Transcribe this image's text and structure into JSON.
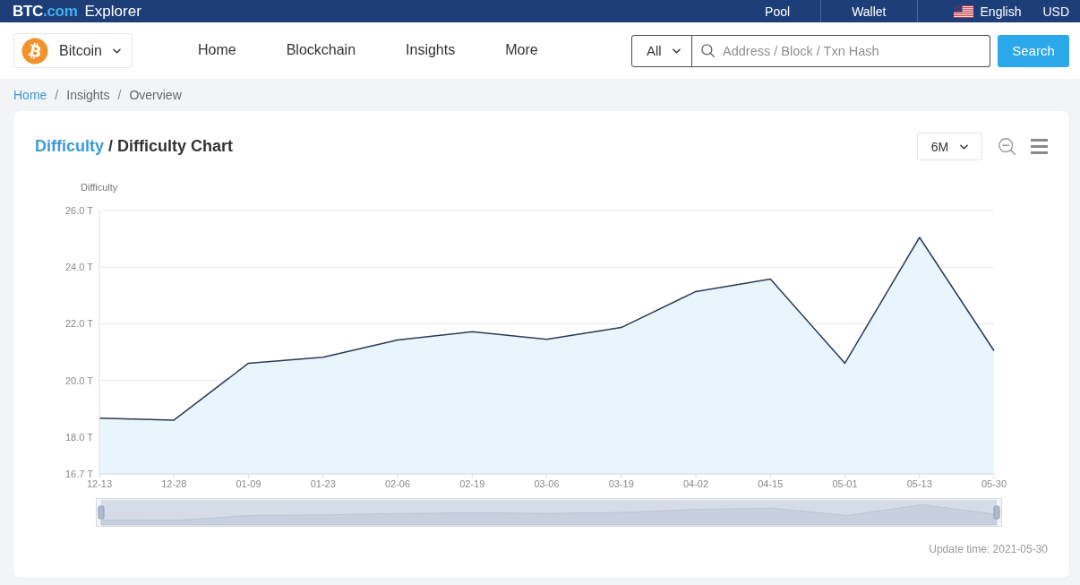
{
  "top_bar": {
    "logo": {
      "brand": "BTC",
      "domain": ".com",
      "product": "Explorer"
    },
    "links": [
      "Pool",
      "Wallet"
    ],
    "language": "English",
    "currency": "USD"
  },
  "nav": {
    "coin": "Bitcoin",
    "items": [
      {
        "label": "Home",
        "selected": false
      },
      {
        "label": "Blockchain",
        "selected": false
      },
      {
        "label": "Insights",
        "selected": false
      },
      {
        "label": "More",
        "selected": false
      }
    ],
    "search": {
      "scope": "All",
      "placeholder": "Address / Block / Txn Hash",
      "button": "Search"
    }
  },
  "breadcrumb": [
    {
      "label": "Home",
      "link": true
    },
    {
      "separator": "/",
      "label": "Insights",
      "link": false
    },
    {
      "separator": "/",
      "label": "Overview",
      "link": false
    }
  ],
  "card": {
    "title": {
      "parent": "Difficulty",
      "separator": "/",
      "current": "Difficulty Chart"
    },
    "period": "6M",
    "chart_data": {
      "type": "area",
      "ylabel": "Difficulty",
      "grid": true,
      "categories": [
        "12-13",
        "12-28",
        "01-09",
        "01-23",
        "02-06",
        "02-19",
        "03-06",
        "03-19",
        "04-02",
        "04-15",
        "05-01",
        "05-13",
        "05-30"
      ],
      "series": [
        {
          "color": "#2b3a55",
          "values": [
            18.67,
            18.6,
            20.61,
            20.82,
            21.43,
            21.72,
            21.45,
            21.87,
            23.14,
            23.58,
            20.61,
            25.05,
            21.05
          ]
        }
      ],
      "ylim": [
        16.7,
        26
      ],
      "yticks": [
        {
          "value": 16.7,
          "label": "16.7 T"
        },
        {
          "value": 18,
          "label": "18.0 T"
        },
        {
          "value": 20,
          "label": "20.0 T"
        },
        {
          "value": 22,
          "label": "22.0 T"
        },
        {
          "value": 24,
          "label": "24.0 T"
        },
        {
          "value": 26,
          "label": "26.0 T"
        }
      ]
    },
    "zoom_slider": {
      "level": 1
    },
    "update_time": "Update time: 2021-05-30"
  }
}
